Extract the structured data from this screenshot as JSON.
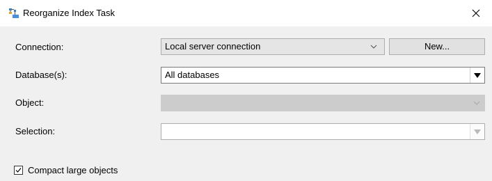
{
  "window": {
    "title": "Reorganize Index Task",
    "icon": "reorganize-index-task-icon",
    "close_icon": "close-icon"
  },
  "form": {
    "connection": {
      "label": "Connection:",
      "value": "Local server connection",
      "new_button": "New..."
    },
    "databases": {
      "label": "Database(s):",
      "value": "All databases"
    },
    "object": {
      "label": "Object:",
      "value": "",
      "enabled": false
    },
    "selection": {
      "label": "Selection:",
      "value": "",
      "enabled": false
    },
    "compact_large_objects": {
      "label": "Compact large objects",
      "checked": true
    }
  },
  "colors": {
    "window_bg": "#f0f0f0",
    "titlebar_bg": "#ffffff",
    "disabled_combo_bg": "#cccccc"
  }
}
